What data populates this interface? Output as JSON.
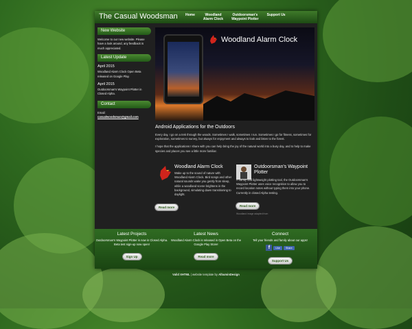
{
  "site": {
    "title": "The Casual Woodsman"
  },
  "nav": [
    {
      "label": "Home"
    },
    {
      "label": "Woodland\nAlarm Clock"
    },
    {
      "label": "Outdoorsman's\nWaypoint Plotter"
    },
    {
      "label": "Support Us"
    }
  ],
  "sidebar": {
    "new_website": {
      "heading": "New Website",
      "text": "Welcome to our new website. Please have a look around, any feedback is much appreciated."
    },
    "latest_update": {
      "heading": "Latest Update",
      "entries": [
        {
          "date": "April 2015",
          "text": "Woodland Alarm Clock Open Beta released on Google Play."
        },
        {
          "date": "April 2015",
          "text": "Outdoorsman's Waypoint Plotter in Closed Alpha."
        }
      ]
    },
    "contact": {
      "heading": "Contact",
      "email_label": "Email:",
      "email": "casualwoodsman@gmail.com"
    }
  },
  "hero": {
    "title": "Woodland Alarm Clock"
  },
  "intro": {
    "heading": "Android Applications for the Outdoors",
    "paragraphs": [
      "Every day, I go on a trek through the woods. Sometimes I walk, sometimes I run. Sometimes I go for fitness, sometimes for exploration, sometimes to survey, but always for enjoyment and always to look and listen to the forest.",
      "I hope that the applications I share with you can help bring the joy of the natural world into a busy day, and to help to make species and places you see a little more familiar."
    ]
  },
  "apps": [
    {
      "title": "Woodland Alarm Clock",
      "description": "Wake up to the sound of nature with Woodland Alarm Clock. Bird songs and other natural sounds wake you gently from sleep, while a woodland scene brightens in the background, simulating dawn transitioning to daylight.",
      "button": "Read more"
    },
    {
      "title": "Outdoorsman's Waypoint Plotter",
      "description": "A handy and lightweight plotting tool, the Outdoorsman's Waypoint Plotter uses voice recognition to allow you to record location notes without typing them into your phone. Currently in closed Alpha testing.",
      "button": "Read more",
      "caption": "Woodland image adapted from"
    }
  ],
  "footer": {
    "projects": {
      "heading": "Latest Projects",
      "text": "Outdoorsman's Waypoint Plotter is now in Closed Alpha. Beta test sign-up now open!",
      "button": "Sign Up"
    },
    "news": {
      "heading": "Latest News",
      "text": "Woodland Alarm Clock is released in Open Beta on the Google Play Store!",
      "button": "Read more"
    },
    "connect": {
      "heading": "Connect",
      "text": "Tell your friends and family about our apps!",
      "like_label": "Like",
      "share_label": "Share",
      "button": "Support Us"
    }
  },
  "credit": {
    "valid": "Valid XHTML",
    "text": "| website template by",
    "link": "AlbuminDesign"
  },
  "colors": {
    "header": "#2f6b22",
    "accent_green": "#4b8a31",
    "panel": "#202020"
  }
}
